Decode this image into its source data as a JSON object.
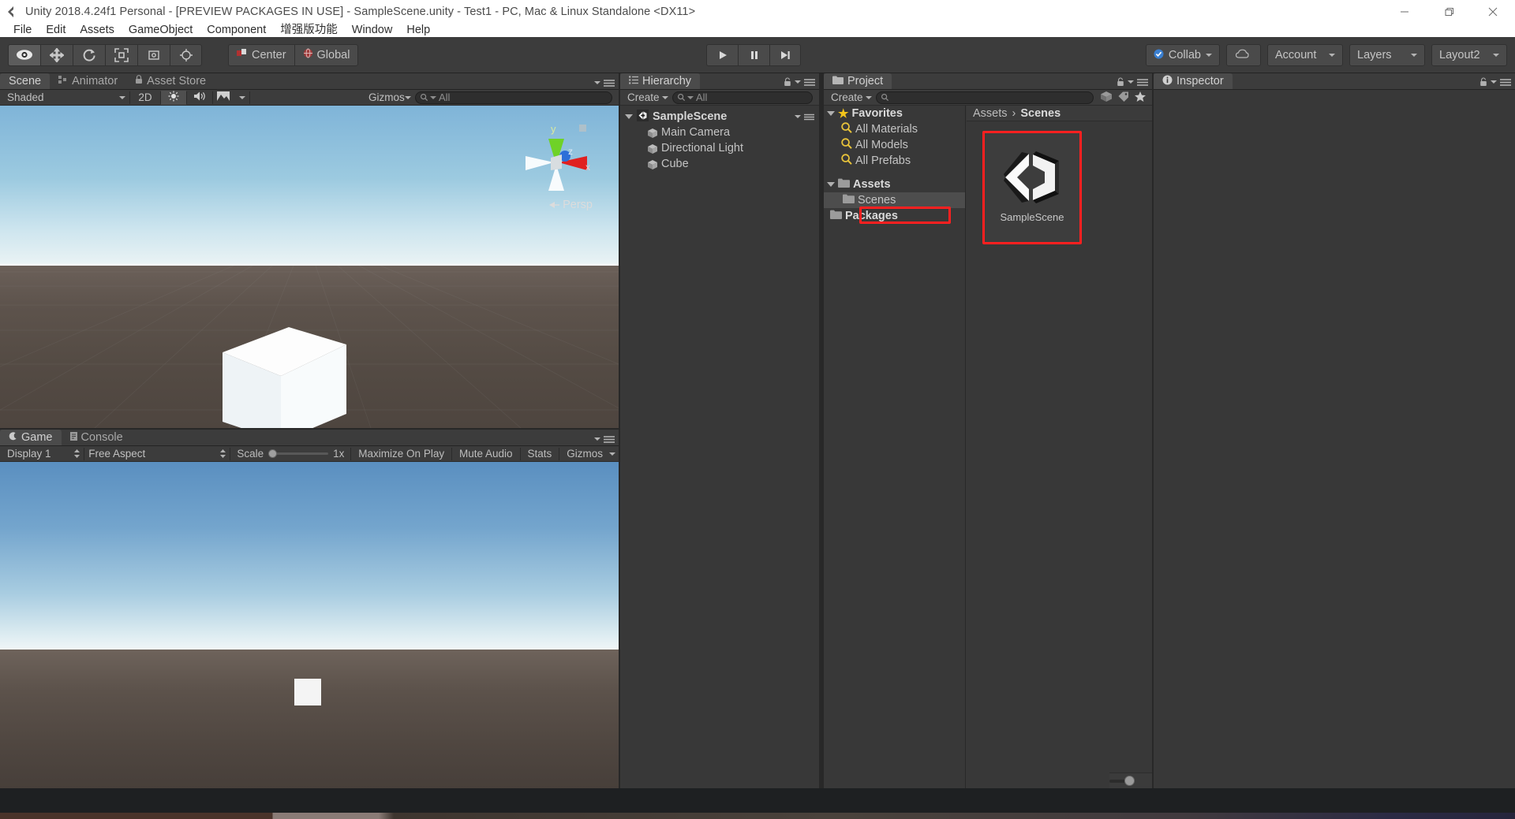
{
  "window": {
    "title": "Unity 2018.4.24f1 Personal - [PREVIEW PACKAGES IN USE] - SampleScene.unity - Test1 - PC, Mac & Linux Standalone <DX11>",
    "logo_icon": "unity-logo-icon",
    "controls": [
      {
        "name": "minimize-button",
        "icon": "minimize-icon"
      },
      {
        "name": "restore-button",
        "icon": "restore-icon"
      },
      {
        "name": "close-button",
        "icon": "close-icon"
      }
    ]
  },
  "menubar": {
    "items": [
      {
        "label": "File"
      },
      {
        "label": "Edit"
      },
      {
        "label": "Assets"
      },
      {
        "label": "GameObject"
      },
      {
        "label": "Component"
      },
      {
        "label": "增强版功能"
      },
      {
        "label": "Window"
      },
      {
        "label": "Help"
      }
    ]
  },
  "toolbar": {
    "tools": [
      {
        "name": "hand-tool",
        "icon": "eye-icon",
        "active": true
      },
      {
        "name": "move-tool",
        "icon": "move-arrows-icon",
        "active": false
      },
      {
        "name": "rotate-tool",
        "icon": "rotate-icon",
        "active": false
      },
      {
        "name": "scale-tool",
        "icon": "scale-icon",
        "active": false
      },
      {
        "name": "rect-tool",
        "icon": "rect-transform-icon",
        "active": false
      },
      {
        "name": "transform-tool",
        "icon": "transform-combined-icon",
        "active": false
      }
    ],
    "pivot_label": "Center",
    "handle_label": "Global",
    "play_controls": [
      {
        "name": "play-button",
        "icon": "play-icon"
      },
      {
        "name": "pause-button",
        "icon": "pause-icon"
      },
      {
        "name": "step-button",
        "icon": "step-icon"
      }
    ],
    "collab_label": "Collab",
    "cloud_icon": "cloud-icon",
    "account_label": "Account",
    "layers_label": "Layers",
    "layout_label": "Layout2"
  },
  "scene_panel": {
    "tabs": [
      {
        "label": "Scene",
        "icon": "scene-icon",
        "active": true
      },
      {
        "label": "Animator",
        "icon": "animator-icon",
        "active": false
      },
      {
        "label": "Asset Store",
        "icon": "asset-store-icon",
        "active": false
      }
    ],
    "toolbar": {
      "draw_mode": "Shaded",
      "two_d": "2D",
      "lighting_icon": "sun-icon",
      "audio_icon": "audio-icon",
      "fx_icon": "image-effects-icon",
      "gizmos_label": "Gizmos",
      "search_placeholder": "All",
      "search_value": ""
    },
    "viewport": {
      "perspective_label": "Persp",
      "gizmo_axes": [
        "y",
        "z",
        "x"
      ]
    }
  },
  "game_panel": {
    "tabs": [
      {
        "label": "Game",
        "icon": "game-icon",
        "active": true
      },
      {
        "label": "Console",
        "icon": "console-icon",
        "active": false
      }
    ],
    "toolbar": {
      "display": "Display 1",
      "aspect": "Free Aspect",
      "scale_label": "Scale",
      "scale_value": "1x",
      "maximize_label": "Maximize On Play",
      "mute_label": "Mute Audio",
      "stats_label": "Stats",
      "gizmos_label": "Gizmos"
    }
  },
  "hierarchy_panel": {
    "tab_label": "Hierarchy",
    "tab_icon": "hierarchy-icon",
    "create_label": "Create",
    "search_placeholder": "All",
    "search_value": "",
    "scene_name": "SampleScene",
    "scene_icon": "unity-scene-icon",
    "objects": [
      {
        "label": "Main Camera",
        "icon": "gameobject-cube-icon"
      },
      {
        "label": "Directional Light",
        "icon": "gameobject-cube-icon"
      },
      {
        "label": "Cube",
        "icon": "gameobject-cube-icon"
      }
    ]
  },
  "project_panel": {
    "tab_label": "Project",
    "tab_icon": "project-folder-icon",
    "create_label": "Create",
    "search_placeholder": "",
    "search_value": "",
    "tree": [
      {
        "label": "Favorites",
        "icon": "star-icon",
        "depth": 0,
        "expanded": true,
        "bold": true
      },
      {
        "label": "All Materials",
        "icon": "search-magnifier-icon",
        "depth": 1,
        "bold": false
      },
      {
        "label": "All Models",
        "icon": "search-magnifier-icon",
        "depth": 1,
        "bold": false
      },
      {
        "label": "All Prefabs",
        "icon": "search-magnifier-icon",
        "depth": 1,
        "bold": false
      },
      {
        "label": "Assets",
        "icon": "folder-icon",
        "depth": 0,
        "expanded": true,
        "bold": true
      },
      {
        "label": "Scenes",
        "icon": "folder-icon",
        "depth": 1,
        "bold": false,
        "selected": true
      },
      {
        "label": "Packages",
        "icon": "folder-icon",
        "depth": 0,
        "expanded": false,
        "bold": true
      }
    ],
    "breadcrumb": [
      "Assets",
      "Scenes"
    ],
    "breadcrumb_separator": "›",
    "assets": [
      {
        "label": "SampleScene",
        "icon": "unity-scene-asset-icon",
        "highlighted": true
      }
    ],
    "highlight_color": "#ff2020"
  },
  "inspector_panel": {
    "tab_label": "Inspector",
    "tab_icon": "info-circle-icon"
  }
}
